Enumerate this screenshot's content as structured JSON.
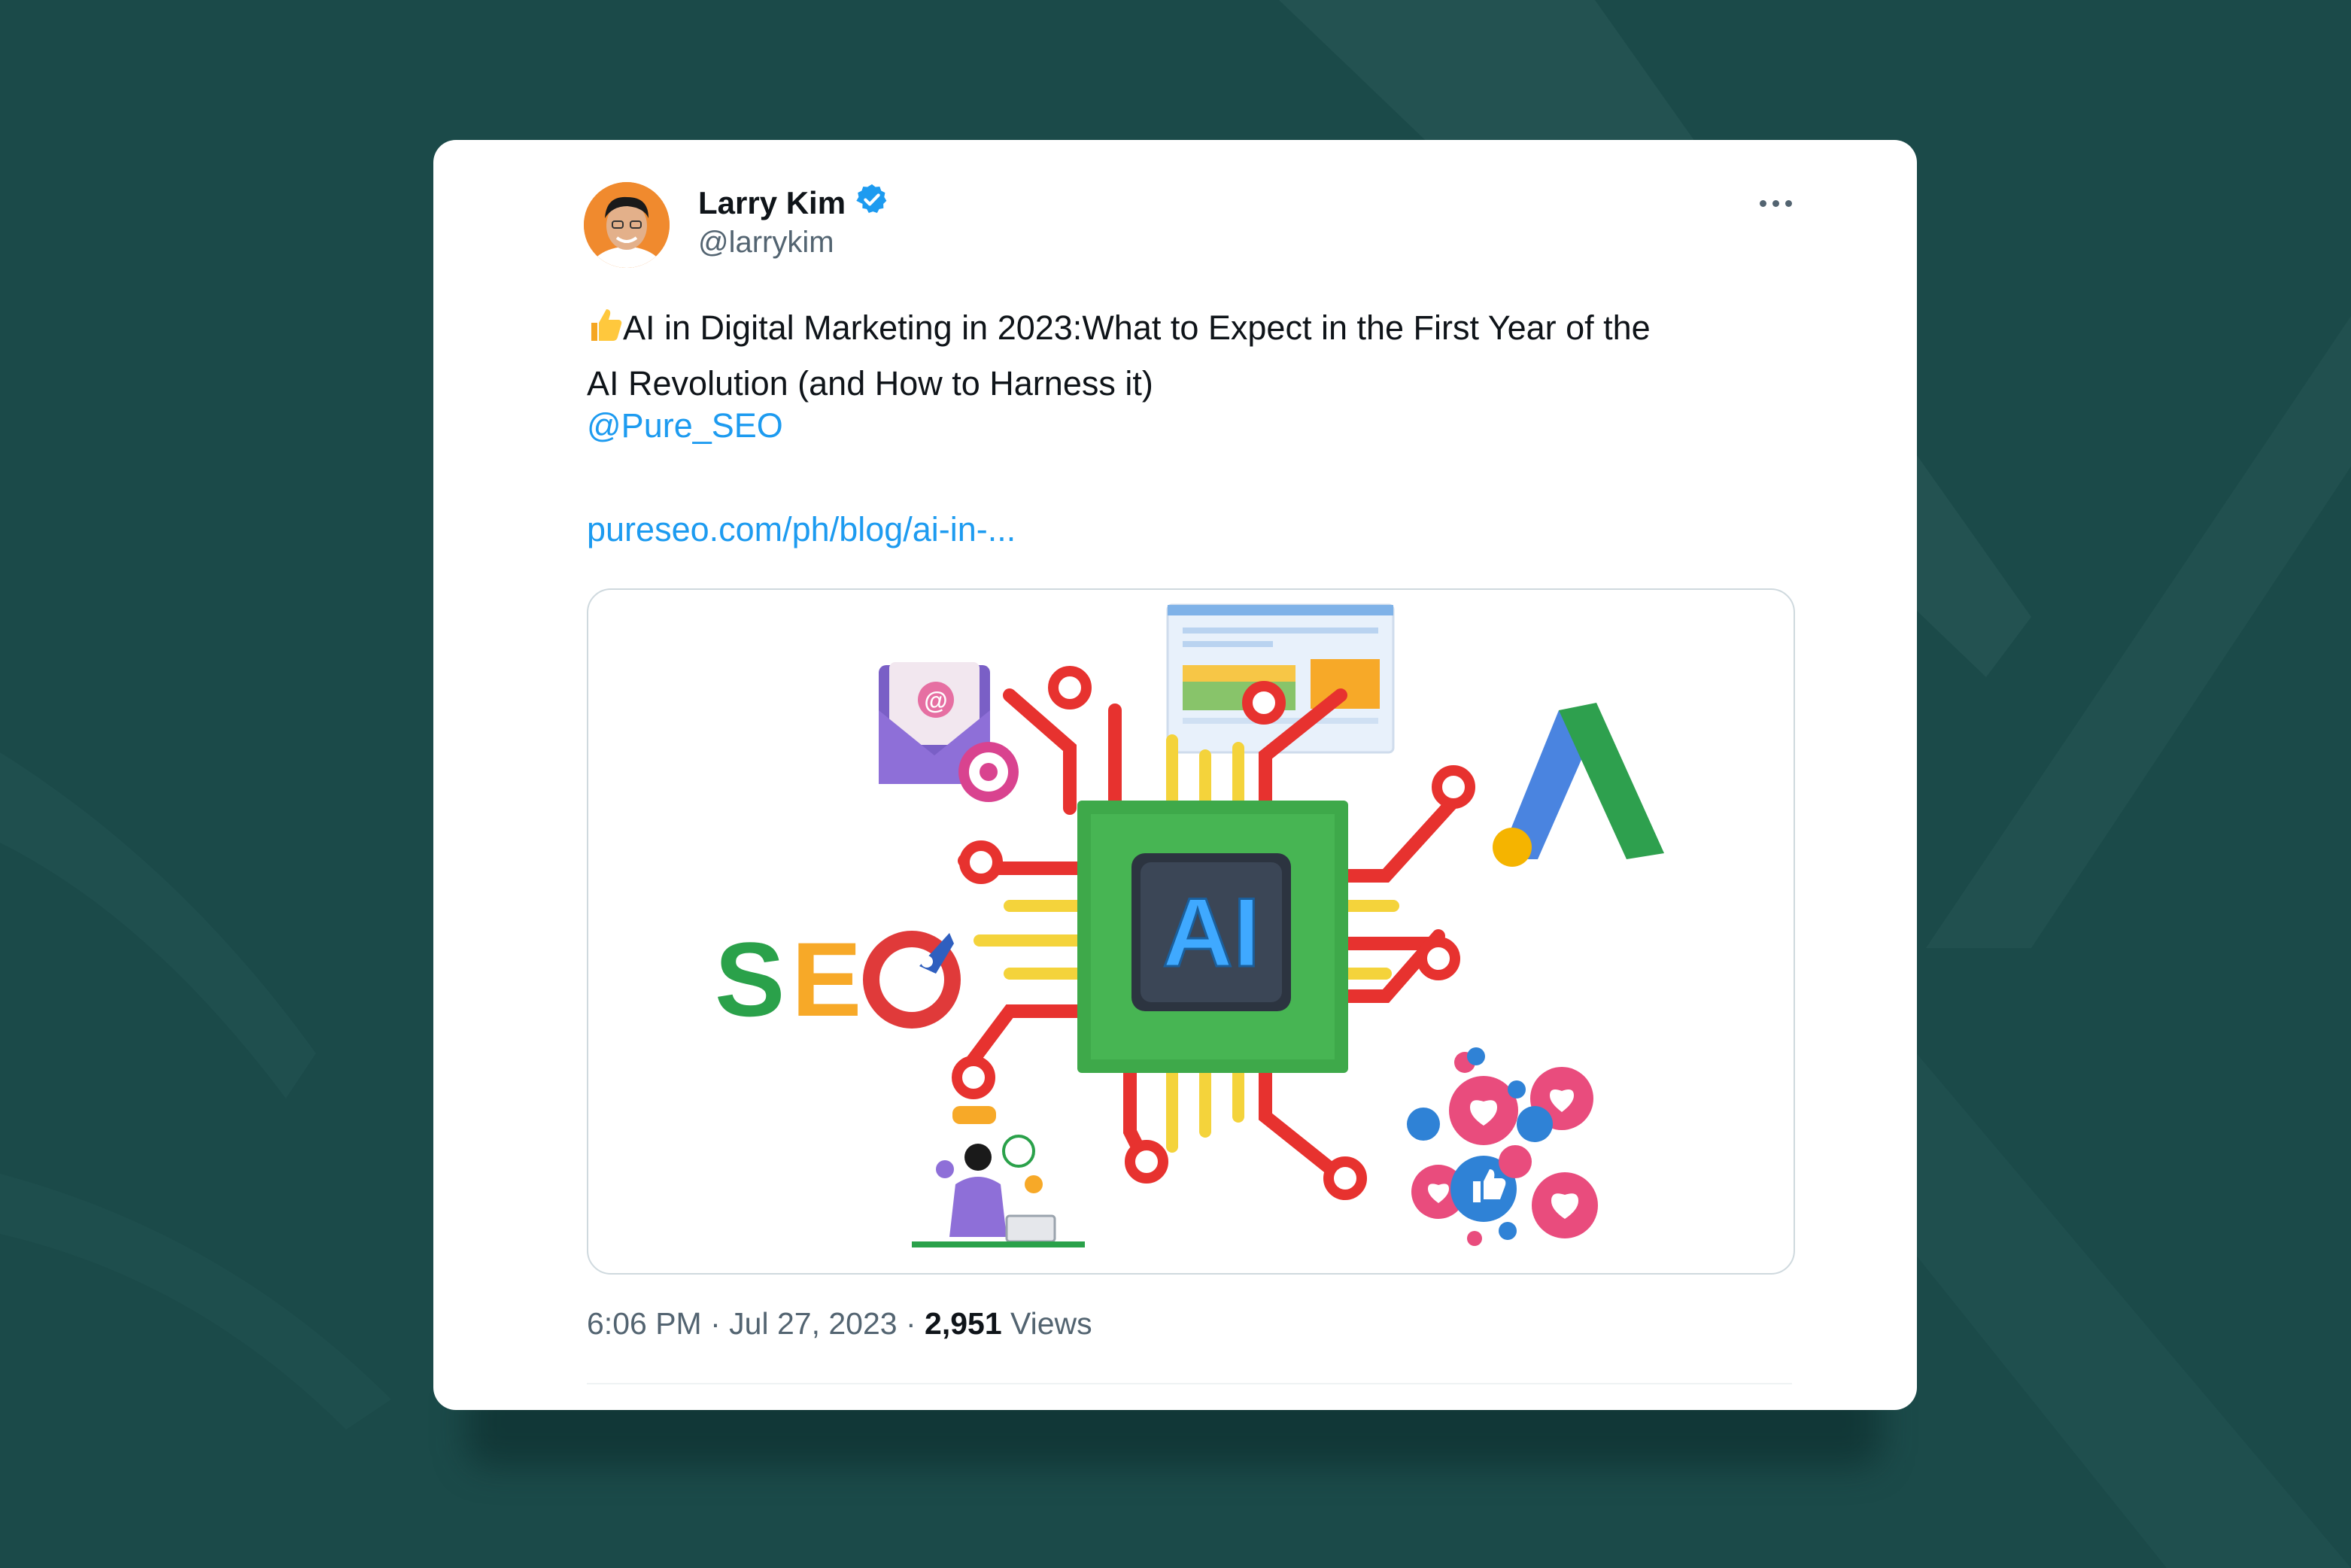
{
  "tweet": {
    "author_name": "Larry Kim",
    "author_handle": "@larrykim",
    "text_line1": "AI in Digital Marketing in 2023:What to Expect in the First Year of the",
    "text_line2": "AI Revolution (and How to Harness it)",
    "mention": "@Pure_SEO",
    "link": "pureseo.com/ph/blog/ai-in-...",
    "time": "6:06 PM",
    "date": "Jul 27, 2023",
    "views_count": "2,951",
    "views_label": "Views"
  },
  "media": {
    "chip_label": "AI",
    "seo_letters": [
      "S",
      "E"
    ],
    "email_symbol": "@"
  },
  "icons": {
    "verified": "verified-badge-icon",
    "more": "more-options-icon",
    "thumbs_up": "thumbs-up-emoji-icon"
  },
  "colors": {
    "background": "#1b4a49",
    "link": "#1d9bf0",
    "verified": "#1d9bf0",
    "seo_s": "#2aa14a",
    "seo_e": "#f7a928",
    "chip_green": "#3ea94a",
    "circuit_red": "#e7322f",
    "circuit_yellow": "#f4d33b"
  }
}
